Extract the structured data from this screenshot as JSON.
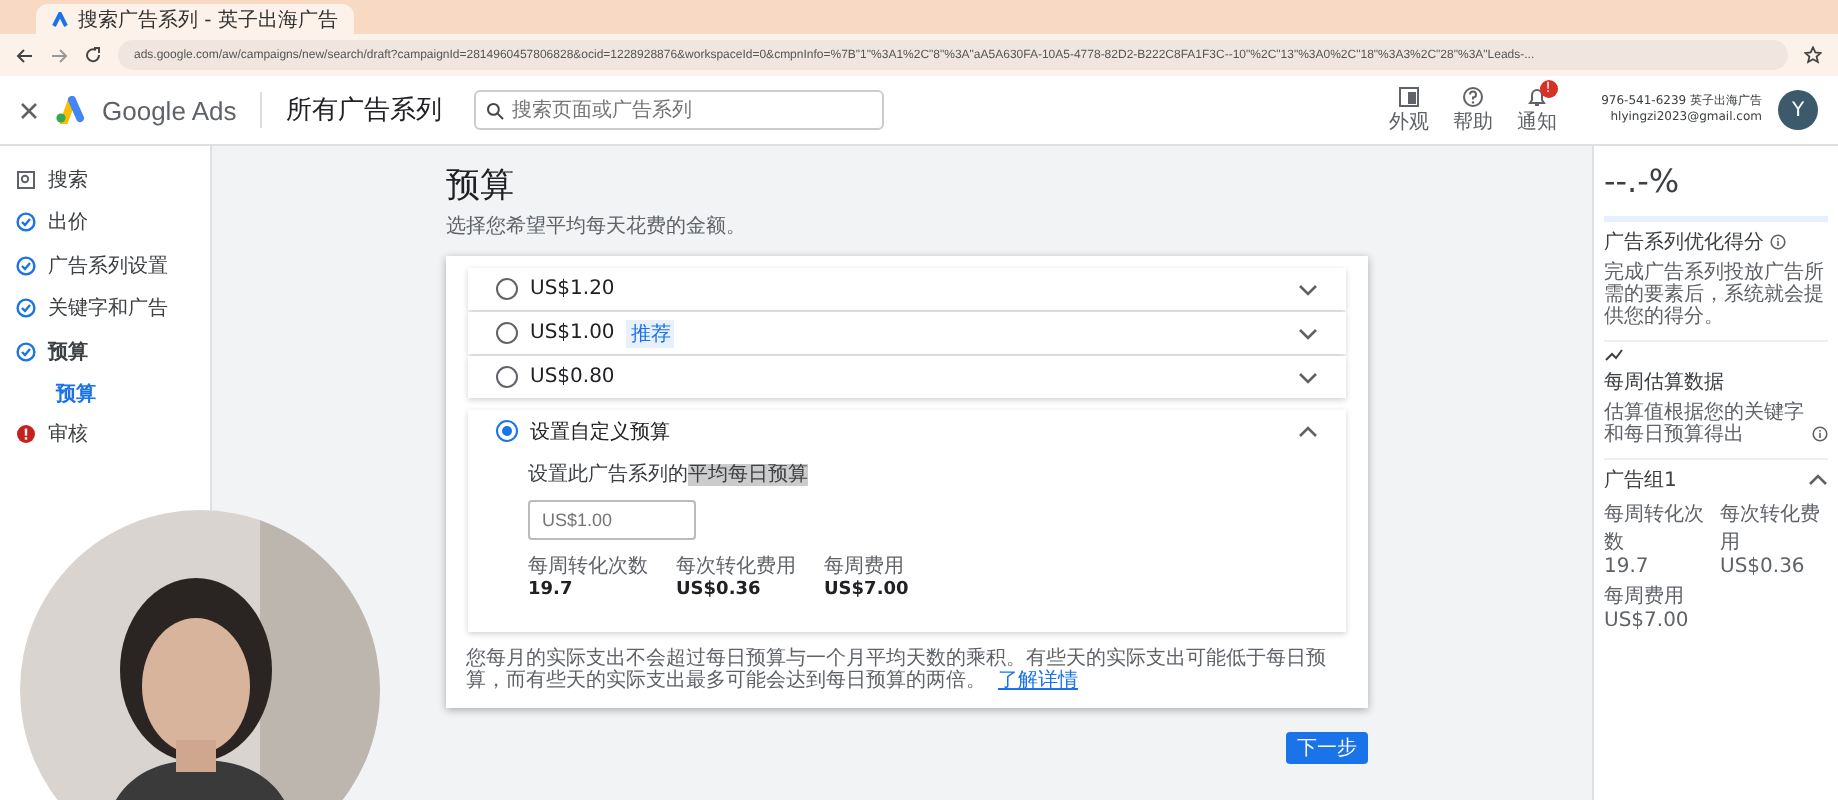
{
  "browser": {
    "tab_title": "搜索广告系列 - 英子出海广告",
    "url": "ads.google.com/aw/campaigns/new/search/draft?campaignId=2814960457806828&ocid=1228928876&workspaceId=0&cmpnInfo=%7B\"1\"%3A1%2C\"8\"%3A\"aA5A630FA-10A5-4778-82D2-B222C8FA1F3C--10\"%2C\"13\"%3A0%2C\"18\"%3A3%2C\"28\"%3A\"Leads-..."
  },
  "header": {
    "product": "Google Ads",
    "page_title": "所有广告系列",
    "search": {
      "placeholder": "搜索页面或广告系列"
    },
    "actions": [
      {
        "kind": "appearance",
        "label": "外观"
      },
      {
        "kind": "help",
        "label": "帮助"
      },
      {
        "kind": "bell",
        "label": "通知",
        "badge": "!"
      }
    ],
    "account": {
      "id": "976-541-6239 英子出海广告",
      "email": "hlyingzi2023@gmail.com",
      "avatar": "Y"
    }
  },
  "sidebar": {
    "items": [
      {
        "kind": "search",
        "label": "搜索",
        "selected": false
      },
      {
        "kind": "done",
        "label": "出价",
        "selected": false
      },
      {
        "kind": "done",
        "label": "广告系列设置",
        "selected": false
      },
      {
        "kind": "done",
        "label": "关键字和广告",
        "selected": false
      },
      {
        "kind": "done",
        "label": "预算",
        "selected": true,
        "children": [
          {
            "label": "预算",
            "selected": true
          }
        ]
      },
      {
        "kind": "error",
        "label": "审核",
        "selected": false
      }
    ]
  },
  "budget": {
    "title": "预算",
    "subtitle": "选择您希望平均每天花费的金额。",
    "options": [
      {
        "label": "US$1.20",
        "selected": false,
        "expanded": false
      },
      {
        "label": "US$1.00",
        "badge": "推荐",
        "selected": false,
        "expanded": false
      },
      {
        "label": "US$0.80",
        "selected": false,
        "expanded": false
      },
      {
        "label": "设置自定义预算",
        "selected": true,
        "expanded": true,
        "prompt": "设置此广告系列的",
        "prompt_highlight": "平均每日预算",
        "placeholder": "US$1.00",
        "stats": [
          {
            "label": "每周转化次数",
            "value": "19.7"
          },
          {
            "label": "每次转化费用",
            "value": "US$0.36"
          },
          {
            "label": "每周费用",
            "value": "US$7.00"
          }
        ]
      }
    ],
    "note": "您每月的实际支出不会超过每日预算与一个月平均天数的乘积。有些天的实际支出可能低于每日预算，而有些天的实际支出最多可能会达到每日预算的两倍。",
    "note_link": "了解详情",
    "next_button": "下一步"
  },
  "right_panel": {
    "score": "--.-%",
    "score_title": "广告系列优化得分",
    "score_text": "完成广告系列投放广告所需的要素后，系统就会提供您的得分。",
    "estimate_title": "每周估算数据",
    "estimate_text": "估算值根据您的关键字和每日预算得出",
    "ad_group": {
      "title": "广告组1",
      "expanded": true,
      "stats": [
        {
          "label": "每周转化次数",
          "value": "19.7"
        },
        {
          "label": "每次转化费用",
          "value": "US$0.36"
        },
        {
          "label": "每周费用",
          "value": "US$7.00"
        }
      ]
    }
  }
}
